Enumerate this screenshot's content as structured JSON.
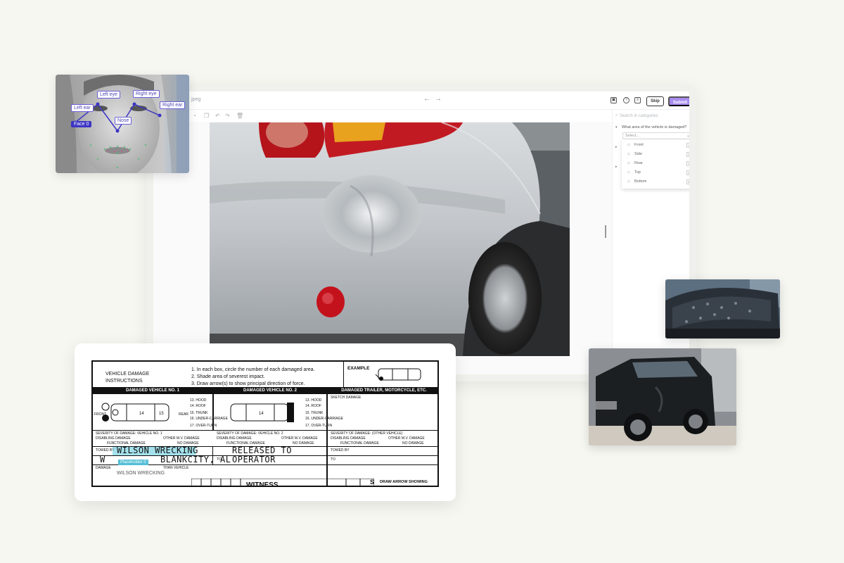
{
  "app": {
    "filename": "jpeg",
    "skip_label": "Skip",
    "submit_label": "Submit",
    "sidebar": {
      "search_placeholder": "Search in categories",
      "question": "What area of the vehicle is damaged?",
      "select_placeholder": "Select...",
      "options": [
        {
          "label": "Front",
          "key": "1"
        },
        {
          "label": "Side",
          "key": "2"
        },
        {
          "label": "Rear",
          "key": "3"
        },
        {
          "label": "Top",
          "key": "4"
        },
        {
          "label": "Bottom",
          "key": "5"
        }
      ]
    }
  },
  "face": {
    "labels": {
      "left_eye": "Left eye",
      "right_eye": "Right eye",
      "left_ear": "Left ear",
      "right_ear": "Right ear",
      "nose": "Nose",
      "face": "Face 0"
    }
  },
  "form": {
    "instructions_title_1": "VEHICLE DAMAGE",
    "instructions_title_2": "INSTRUCTIONS",
    "instruction_1": "1. In each box, circle the number of each damaged area.",
    "instruction_2": "2. Shade area of severest impact.",
    "instruction_3": "3. Draw arrow(s) to show principal direction of force.",
    "example": "EXAMPLE",
    "col1": "DAMAGED VEHICLE NO. 1",
    "col2": "DAMAGED VEHICLE NO. 2",
    "col3": "DAMAGED TRAILER, MOTORCYCLE, ETC.",
    "sketch": "SKETCH DAMAGE",
    "parts": [
      "13. HOOD",
      "14. ROOF",
      "15. TRUNK",
      "16. UNDER-CARRIAGE",
      "17. OVER-TURN"
    ],
    "severity_1": "SEVERITY OF DAMAGE: VEHICLE NO. 1",
    "severity_2": "SEVERITY OF DAMAGE: VEHICLE NO. 2",
    "severity_3": "SEVERITY OF DAMAGE: (OTHER VEHICLE)",
    "disabling": "DISABLING DAMAGE",
    "other_mv": "OTHER M.V. DAMAGE",
    "functional": "FUNCTIONAL DAMAGE",
    "no_damage": "NO DAMAGE",
    "towed_by": "TOWED BY",
    "to": "TO",
    "hand_1": "WILSON WRECKING",
    "hand_2": "W",
    "hand_2b": "BLANKCITY, AL",
    "hand_3": "RELEASED TO",
    "hand_4": "OPERATOR",
    "damage_other": "DAMAGE",
    "damage_other_2": "THAN VEHICLE",
    "witness": "WITNESS",
    "draw_arrow": "DRAW ARROW SHOWING",
    "tag_label": "Placeholder 0",
    "tag_value": "WILSON WRECKING",
    "front": "FRONT",
    "rear": "REAR",
    "small_s": "S"
  },
  "colors": {
    "accent": "#a98cf0",
    "keypoint": "#3c35c4",
    "highlight": "#55bfd6"
  }
}
